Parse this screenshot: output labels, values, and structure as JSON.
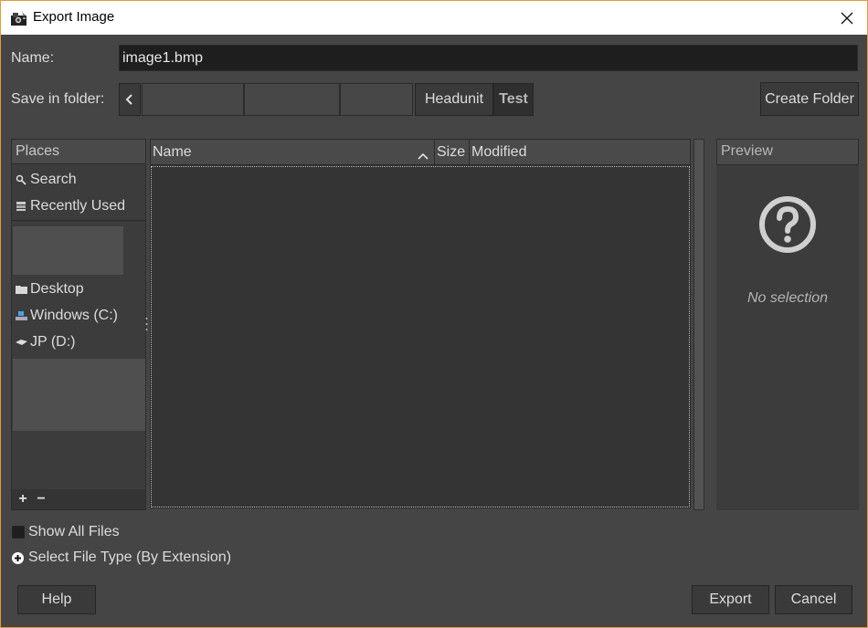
{
  "window": {
    "title": "Export Image",
    "accent": "#e49a3a"
  },
  "icons": {
    "app": "gimp-wilber-icon",
    "close": "close-icon",
    "back": "chevron-left-icon",
    "search": "search-icon",
    "recent": "recently-used-icon",
    "folder": "folder-icon",
    "drive_c": "windows-drive-icon",
    "drive_d": "removable-drive-icon",
    "sort": "chevron-up-icon",
    "preview": "question-mark-icon"
  },
  "name_row": {
    "label": "Name:",
    "value": "image1.bmp"
  },
  "folder_row": {
    "label": "Save in folder:",
    "path": [
      "",
      "",
      "",
      "Headunit",
      "Test"
    ],
    "create_folder": "Create Folder"
  },
  "places": {
    "header": "Places",
    "items": [
      "Search",
      "Recently Used",
      "Desktop",
      "Windows (C:)",
      "JP (D:)"
    ],
    "add": "+",
    "remove": "−"
  },
  "file_list": {
    "columns": [
      "Name",
      "Size",
      "Modified"
    ],
    "sort_column": "Name",
    "rows": []
  },
  "preview": {
    "header": "Preview",
    "status": "No selection"
  },
  "options": {
    "show_all_files": "Show All Files",
    "show_all_checked": false,
    "select_file_type": "Select File Type (By Extension)"
  },
  "buttons": {
    "help": "Help",
    "export": "Export",
    "cancel": "Cancel"
  }
}
